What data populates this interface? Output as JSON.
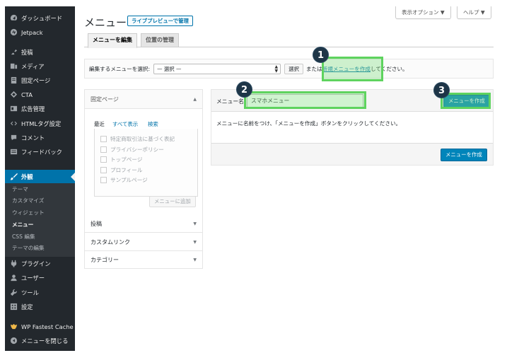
{
  "sidebar": {
    "items": [
      {
        "label": "ダッシュボード",
        "icon": "dashboard-icon"
      },
      {
        "label": "Jetpack",
        "icon": "jetpack-icon"
      },
      {
        "label": "投稿",
        "icon": "pin-icon"
      },
      {
        "label": "メディア",
        "icon": "media-icon"
      },
      {
        "label": "固定ページ",
        "icon": "page-icon"
      },
      {
        "label": "CTA",
        "icon": "cta-icon"
      },
      {
        "label": "広告管理",
        "icon": "ad-icon"
      },
      {
        "label": "HTMLタグ設定",
        "icon": "code-icon"
      },
      {
        "label": "コメント",
        "icon": "comment-icon"
      },
      {
        "label": "フィードバック",
        "icon": "feedback-icon"
      },
      {
        "label": "外観",
        "icon": "appearance-brush-icon"
      },
      {
        "label": "プラグイン",
        "icon": "plugin-icon"
      },
      {
        "label": "ユーザー",
        "icon": "user-icon"
      },
      {
        "label": "ツール",
        "icon": "wrench-icon"
      },
      {
        "label": "設定",
        "icon": "settings-icon"
      },
      {
        "label": "WP Fastest Cache",
        "icon": "cheetah-icon"
      },
      {
        "label": "メニューを閉じる",
        "icon": "collapse-icon"
      }
    ],
    "submenu": [
      "テーマ",
      "カスタマイズ",
      "ウィジェット",
      "メニュー",
      "CSS 編集",
      "テーマの編集"
    ]
  },
  "screen_options": "表示オプション ▼",
  "help": "ヘルプ ▼",
  "page_title": "メニュー",
  "live_preview_button": "ライブプレビューで管理",
  "tabs": [
    "メニューを編集",
    "位置の管理"
  ],
  "manage": {
    "label": "編集するメニューを選択:",
    "select_value": "— 選択 —",
    "select_button": "選択",
    "or_text": "または",
    "create_link": "新規メニューを作成",
    "suffix": "してください。"
  },
  "accordion": {
    "open_section": "固定ページ",
    "subtabs": [
      "最近",
      "すべて表示",
      "検索"
    ],
    "pages": [
      "特定商取引法に基づく表記",
      "プライバシーポリシー",
      "トップページ",
      "プロフィール",
      "サンプルページ"
    ],
    "add_button": "メニューに追加",
    "sections": [
      "投稿",
      "カスタムリンク",
      "カテゴリー"
    ]
  },
  "edit": {
    "name_label": "メニュー名",
    "name_value": "スマホメニュー",
    "create_button": "メニューを作成",
    "instructions": "メニューに名前をつけ、「メニューを作成」ボタンをクリックしてください。"
  },
  "annotations": [
    "1",
    "2",
    "3"
  ],
  "colors": {
    "sidebar_bg": "#23282d",
    "accent": "#0073aa",
    "primary_button": "#0085ba",
    "highlight": "#5ed35e",
    "badge": "#1e3547"
  }
}
